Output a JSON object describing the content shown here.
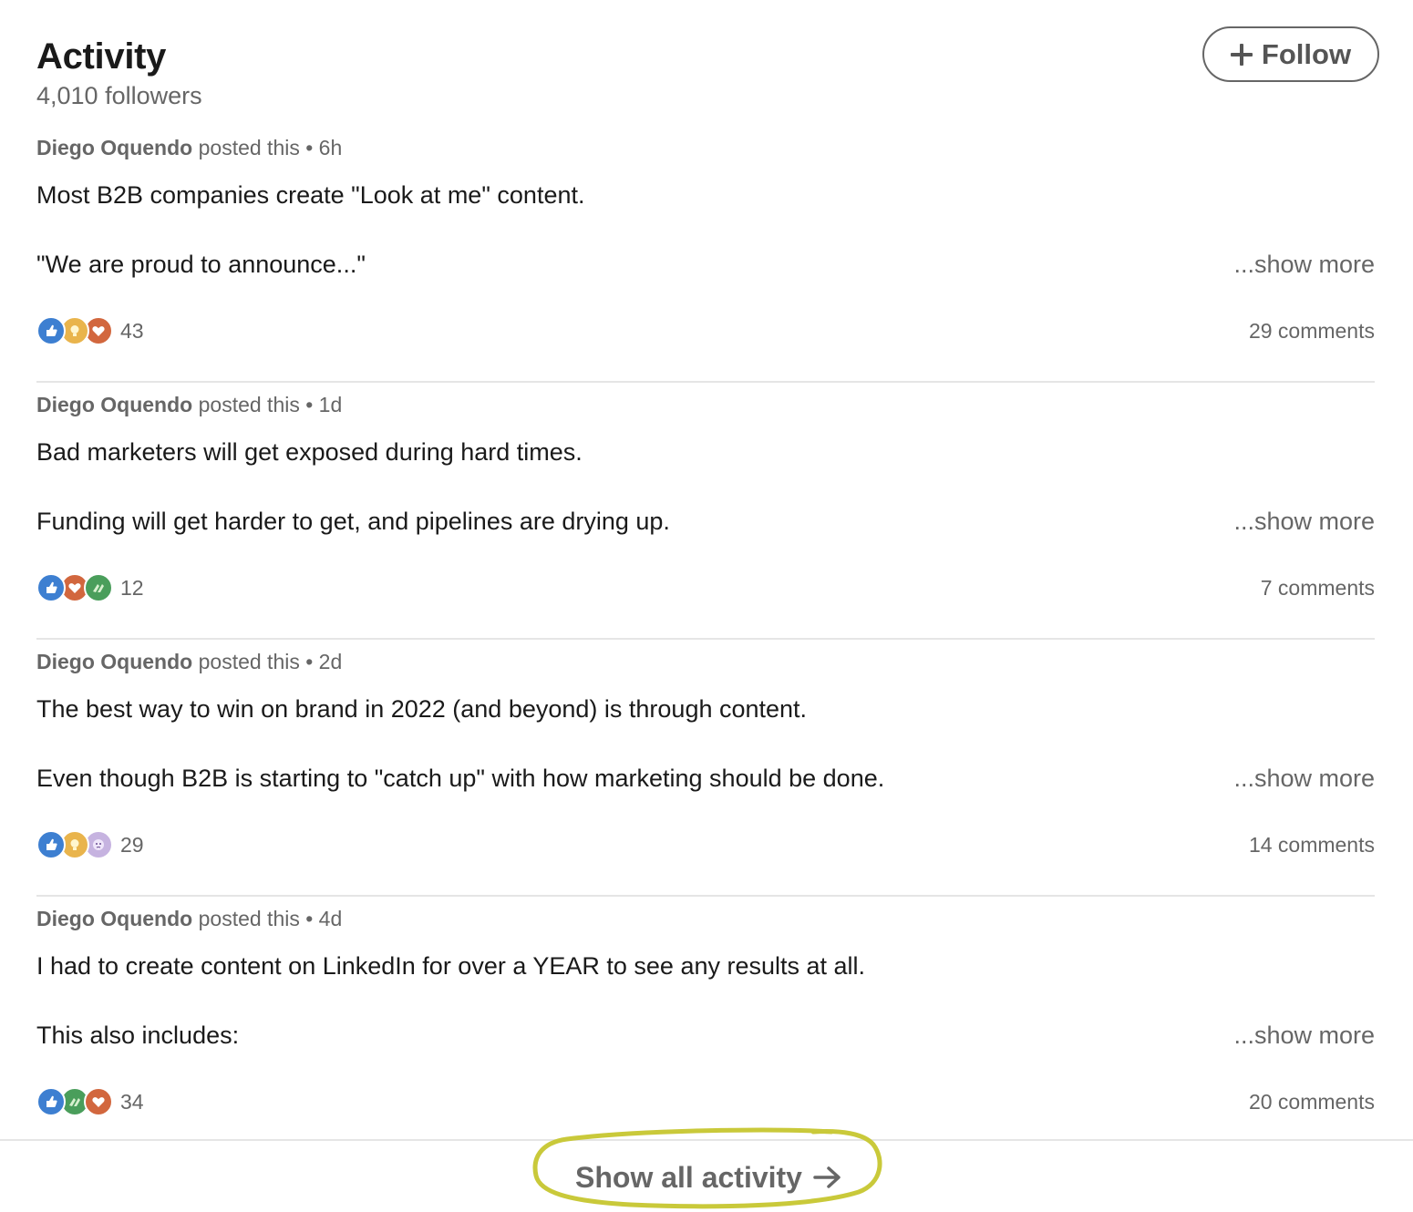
{
  "header": {
    "title": "Activity",
    "followers": "4,010 followers",
    "follow_label": "Follow"
  },
  "posts": [
    {
      "author": "Diego Oquendo",
      "action": " posted this • 6h",
      "line1": "Most B2B companies create \"Look at me\" content.",
      "line2": "\"We are proud to announce...\"",
      "show_more": "...show more",
      "reaction_icons": [
        "like",
        "insight",
        "love"
      ],
      "reaction_count": "43",
      "comments": "29 comments"
    },
    {
      "author": "Diego Oquendo",
      "action": " posted this • 1d",
      "line1": "Bad marketers will get exposed during hard times.",
      "line2": "Funding will get harder to get, and pipelines are drying up.",
      "show_more": "...show more",
      "reaction_icons": [
        "like",
        "love",
        "support"
      ],
      "reaction_count": "12",
      "comments": "7 comments"
    },
    {
      "author": "Diego Oquendo",
      "action": " posted this • 2d",
      "line1": "The best way to win on brand in 2022 (and beyond) is through content.",
      "line2": "Even though B2B is starting to \"catch up\" with how marketing should be done.",
      "show_more": "...show more",
      "reaction_icons": [
        "like",
        "insight",
        "curious"
      ],
      "reaction_count": "29",
      "comments": "14 comments"
    },
    {
      "author": "Diego Oquendo",
      "action": " posted this • 4d",
      "line1": "I had to create content on LinkedIn for over a YEAR to see any results at all.",
      "line2": "This also includes:",
      "show_more": "...show more",
      "reaction_icons": [
        "like",
        "support",
        "love"
      ],
      "reaction_count": "34",
      "comments": "20 comments"
    }
  ],
  "footer": {
    "show_all_label": "Show all activity"
  },
  "colors": {
    "like": "#3d7fd1",
    "insight": "#e9b44c",
    "love": "#d2673e",
    "support": "#4a9e5b",
    "curious": "#c6b3e0",
    "highlight": "#c9c93a"
  }
}
